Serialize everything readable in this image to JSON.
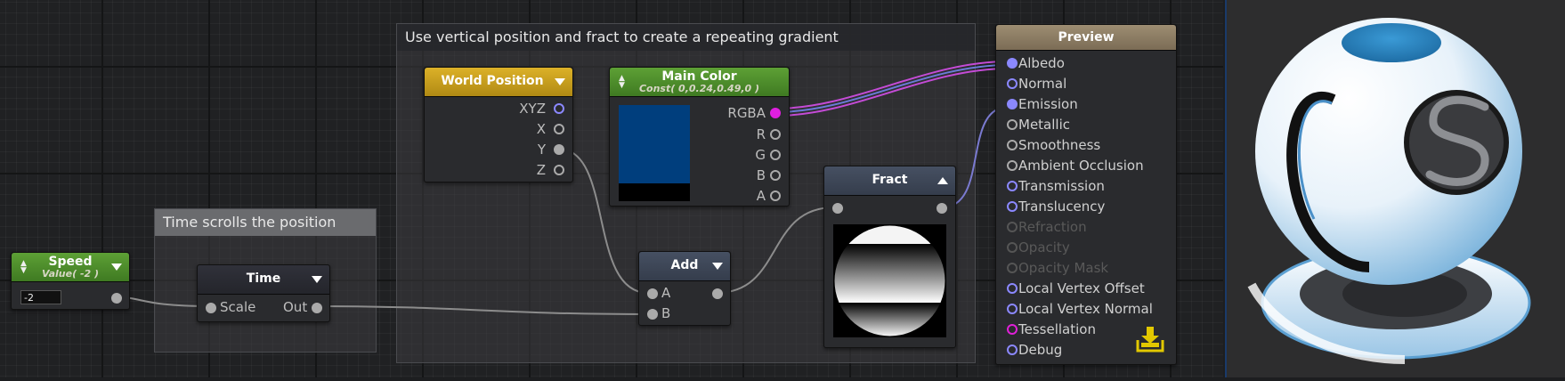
{
  "comments": {
    "gradient": "Use vertical position and fract to create a repeating gradient",
    "time": "Time scrolls the position"
  },
  "nodes": {
    "speed": {
      "title": "Speed",
      "subtitle": "Value( -2 )",
      "field_value": "-2"
    },
    "time": {
      "title": "Time",
      "in": "Scale",
      "out": "Out"
    },
    "world_position": {
      "title": "World Position",
      "ports": [
        "XYZ",
        "X",
        "Y",
        "Z"
      ]
    },
    "main_color": {
      "title": "Main Color",
      "subtitle": "Const( 0,0.24,0.49,0 )",
      "ports": [
        "RGBA",
        "R",
        "G",
        "B",
        "A"
      ],
      "swatch_color": "#003e7d"
    },
    "add": {
      "title": "Add",
      "ports": [
        "A",
        "B"
      ]
    },
    "fract": {
      "title": "Fract"
    },
    "output": {
      "title": "Preview",
      "inputs": [
        {
          "label": "Albedo",
          "state": "connected"
        },
        {
          "label": "Normal",
          "state": "open"
        },
        {
          "label": "Emission",
          "state": "connected"
        },
        {
          "label": "Metallic",
          "state": "gray"
        },
        {
          "label": "Smoothness",
          "state": "gray"
        },
        {
          "label": "Ambient Occlusion",
          "state": "gray"
        },
        {
          "label": "Transmission",
          "state": "open"
        },
        {
          "label": "Translucency",
          "state": "open"
        },
        {
          "label": "Refraction",
          "state": "disabled"
        },
        {
          "label": "Opacity",
          "state": "disabled"
        },
        {
          "label": "Opacity Mask",
          "state": "disabled"
        },
        {
          "label": "Local Vertex Offset",
          "state": "open"
        },
        {
          "label": "Local Vertex Normal",
          "state": "open"
        },
        {
          "label": "Tessellation",
          "state": "pink"
        },
        {
          "label": "Debug",
          "state": "open"
        }
      ]
    }
  },
  "colors": {
    "value_header": "#4c8a2a",
    "world_header": "#c9a321",
    "preview_header": "#8a7a5f",
    "function_header": "#3d4656",
    "rgba_wire": "#c44bd6",
    "accent_blue": "#2f8cc7",
    "save_icon": "#e2c800"
  },
  "icons": {
    "save": "save-download-icon",
    "logo": "shader-logo-s"
  }
}
